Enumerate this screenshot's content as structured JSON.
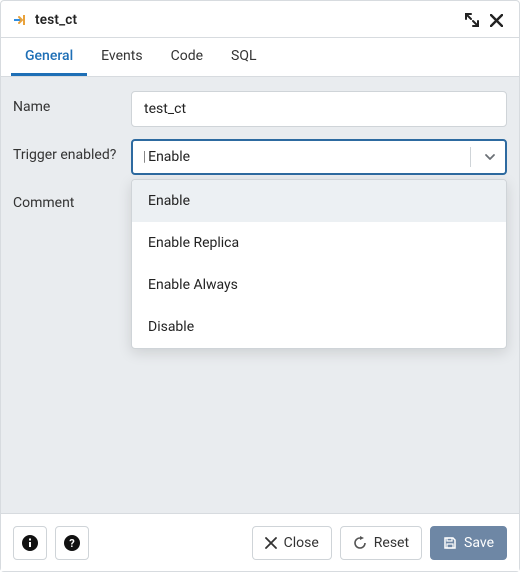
{
  "window": {
    "title": "test_ct",
    "icon": "trigger-icon"
  },
  "tabs": [
    {
      "label": "General",
      "active": true
    },
    {
      "label": "Events",
      "active": false
    },
    {
      "label": "Code",
      "active": false
    },
    {
      "label": "SQL",
      "active": false
    }
  ],
  "form": {
    "name_label": "Name",
    "name_value": "test_ct",
    "trigger_label": "Trigger enabled?",
    "trigger_value": "Enable",
    "trigger_options": [
      "Enable",
      "Enable Replica",
      "Enable Always",
      "Disable"
    ],
    "comment_label": "Comment",
    "comment_value": ""
  },
  "footer": {
    "close_label": "Close",
    "reset_label": "Reset",
    "save_label": "Save"
  },
  "colors": {
    "accent": "#1e6fb6",
    "primary_btn": "#6e87a5"
  }
}
